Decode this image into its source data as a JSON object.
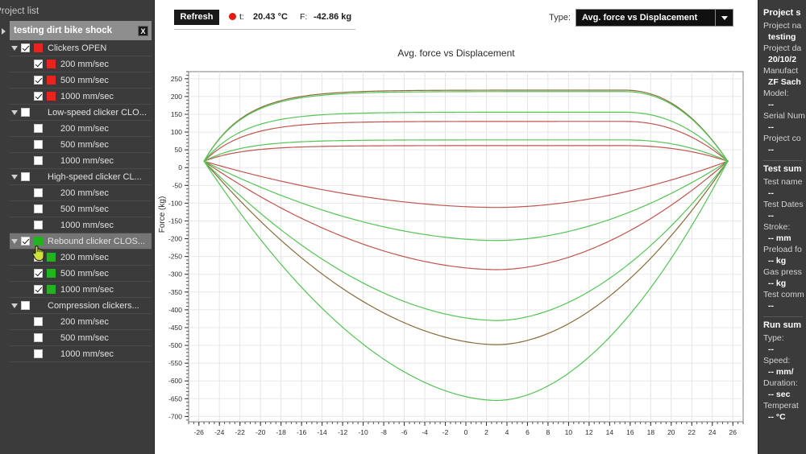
{
  "sidebar": {
    "panel_title": "Project list",
    "project": {
      "name": "testing dirt bike shock",
      "close_label": "X"
    },
    "groups": [
      {
        "label": "Clickers OPEN",
        "checked": true,
        "color": "#e8241b",
        "expanded": true,
        "selected": false,
        "children": [
          {
            "label": "200 mm/sec",
            "checked": true,
            "color": "#e8241b"
          },
          {
            "label": "500 mm/sec",
            "checked": true,
            "color": "#e8241b"
          },
          {
            "label": "1000 mm/sec",
            "checked": true,
            "color": "#e8241b"
          }
        ]
      },
      {
        "label": "Low-speed clicker CLO...",
        "checked": false,
        "color": "",
        "expanded": true,
        "selected": false,
        "children": [
          {
            "label": "200 mm/sec",
            "checked": false,
            "color": ""
          },
          {
            "label": "500 mm/sec",
            "checked": false,
            "color": ""
          },
          {
            "label": "1000 mm/sec",
            "checked": false,
            "color": ""
          }
        ]
      },
      {
        "label": "High-speed clicker CL...",
        "checked": false,
        "color": "",
        "expanded": true,
        "selected": false,
        "children": [
          {
            "label": "200 mm/sec",
            "checked": false,
            "color": ""
          },
          {
            "label": "500 mm/sec",
            "checked": false,
            "color": ""
          },
          {
            "label": "1000 mm/sec",
            "checked": false,
            "color": ""
          }
        ]
      },
      {
        "label": "Rebound clicker CLOS...",
        "checked": true,
        "color": "#22b31e",
        "expanded": true,
        "selected": true,
        "children": [
          {
            "label": "200 mm/sec",
            "checked": true,
            "color": "#22b31e"
          },
          {
            "label": "500 mm/sec",
            "checked": true,
            "color": "#22b31e"
          },
          {
            "label": "1000 mm/sec",
            "checked": true,
            "color": "#22b31e"
          }
        ]
      },
      {
        "label": "Compression clickers...",
        "checked": false,
        "color": "",
        "expanded": true,
        "selected": false,
        "children": [
          {
            "label": "200 mm/sec",
            "checked": false,
            "color": ""
          },
          {
            "label": "500 mm/sec",
            "checked": false,
            "color": ""
          },
          {
            "label": "1000 mm/sec",
            "checked": false,
            "color": ""
          }
        ]
      }
    ]
  },
  "toolbar": {
    "refresh_label": "Refresh",
    "temp_label": "t:",
    "temp_value": "20.43 °C",
    "force_label": "F:",
    "force_value": "-42.86 kg",
    "type_label": "Type:",
    "type_value": "Avg. force vs Displacement",
    "rec_dot_color": "#e01b12"
  },
  "right_panel": {
    "project_section": "Project s",
    "rows": [
      {
        "key": "Project na",
        "val": "testing "
      },
      {
        "key": "Project da",
        "val": "20/10/2"
      },
      {
        "key": "Manufact",
        "val": "ZF Sach"
      },
      {
        "key": "Model:",
        "val": "--"
      },
      {
        "key": "Serial Num",
        "val": "--"
      },
      {
        "key": "Project co",
        "val": "--"
      }
    ],
    "test_section": "Test sum",
    "test_rows": [
      {
        "key": "Test name",
        "val": "--"
      },
      {
        "key": "Test Dates",
        "val": "--"
      },
      {
        "key": "Stroke:",
        "val": "-- mm"
      },
      {
        "key": "Preload fo",
        "val": "-- kg"
      },
      {
        "key": "Gas press",
        "val": "-- kg"
      },
      {
        "key": "Test comm",
        "val": "--"
      }
    ],
    "run_section": "Run sum",
    "run_rows": [
      {
        "key": "Type:",
        "val": "--"
      },
      {
        "key": "Speed:",
        "val": "-- mm/"
      },
      {
        "key": "Duration:",
        "val": "-- sec"
      },
      {
        "key": "Temperat",
        "val": "-- °C"
      }
    ]
  },
  "chart_data": {
    "type": "line",
    "title": "Avg. force vs Displacement",
    "xlabel": "",
    "ylabel": "Force (kg)",
    "xlim": [
      -27,
      27
    ],
    "ylim": [
      -715,
      270
    ],
    "xticks": [
      -26,
      -24,
      -22,
      -20,
      -18,
      -16,
      -14,
      -12,
      -10,
      -8,
      -6,
      -4,
      -2,
      0,
      2,
      4,
      6,
      8,
      10,
      12,
      14,
      16,
      18,
      20,
      22,
      24,
      26
    ],
    "yticks": [
      250,
      200,
      150,
      100,
      50,
      0,
      -50,
      -100,
      -150,
      -200,
      -250,
      -300,
      -350,
      -400,
      -450,
      -500,
      -550,
      -600,
      -650,
      -700
    ],
    "grid": true,
    "legend": "none",
    "note": "Closed hysteresis loops: force vs displacement. Each loop has an upper (rebound/extension) branch and a lower (compression) branch, joined at the left turning point x=-25.5 and the right turning point x=25.5.",
    "series": [
      {
        "name": "Clickers OPEN 200 mm/sec",
        "color": "#c0554f",
        "upper_peak": 62,
        "lower_peak": -112,
        "x_left": -25.5,
        "x_right": 25.5,
        "y_join": 18
      },
      {
        "name": "Clickers OPEN 500 mm/sec",
        "color": "#c0554f",
        "upper_peak": 130,
        "lower_peak": -287,
        "x_left": -25.5,
        "x_right": 25.5,
        "y_join": 18
      },
      {
        "name": "Clickers OPEN 1000 mm/sec",
        "color": "#8a6b3a",
        "upper_peak": 218,
        "lower_peak": -498,
        "x_left": -25.5,
        "x_right": 25.5,
        "y_join": 18
      },
      {
        "name": "Rebound clicker CLOSED 200 mm/sec",
        "color": "#55c455",
        "upper_peak": 78,
        "lower_peak": -205,
        "x_left": -25.5,
        "x_right": 25.5,
        "y_join": 18
      },
      {
        "name": "Rebound clicker CLOSED 500 mm/sec",
        "color": "#55c455",
        "upper_peak": 156,
        "lower_peak": -430,
        "x_left": -25.5,
        "x_right": 25.5,
        "y_join": 18
      },
      {
        "name": "Rebound clicker CLOSED 1000 mm/sec",
        "color": "#55c455",
        "upper_peak": 214,
        "lower_peak": -655,
        "x_left": -25.5,
        "x_right": 25.5,
        "y_join": 18
      }
    ]
  }
}
